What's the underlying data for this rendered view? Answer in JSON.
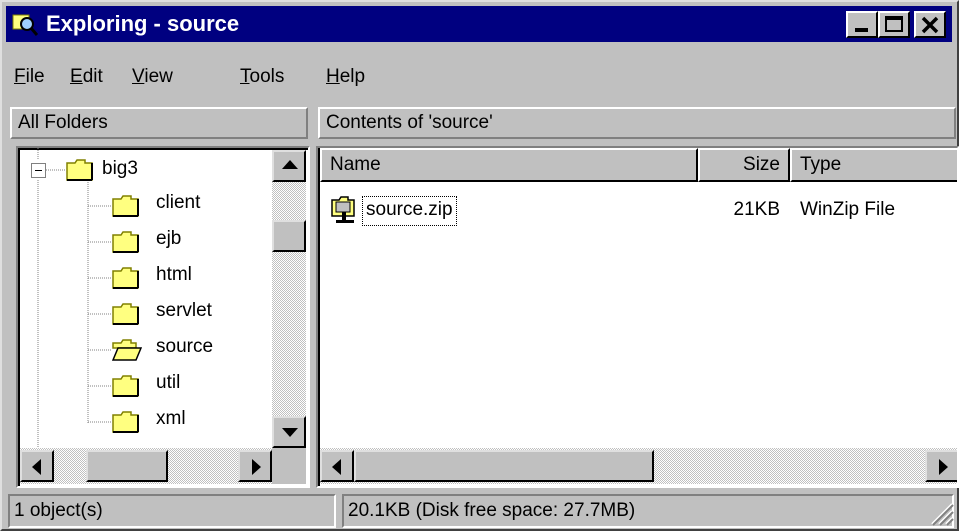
{
  "window": {
    "title": "Exploring - source"
  },
  "menu": [
    {
      "prefix": "",
      "hot": "F",
      "rest": "ile"
    },
    {
      "prefix": "",
      "hot": "E",
      "rest": "dit"
    },
    {
      "prefix": "",
      "hot": "V",
      "rest": "iew"
    },
    {
      "prefix": "",
      "hot": "T",
      "rest": "ools"
    },
    {
      "prefix": "",
      "hot": "H",
      "rest": "elp"
    }
  ],
  "left_header": "All Folders",
  "right_header": "Contents of 'source'",
  "tree": {
    "root": {
      "label": "big3",
      "expander": "−"
    },
    "children": [
      {
        "label": "client",
        "open": false
      },
      {
        "label": "ejb",
        "open": false
      },
      {
        "label": "html",
        "open": false
      },
      {
        "label": "servlet",
        "open": false
      },
      {
        "label": "source",
        "open": true
      },
      {
        "label": "util",
        "open": false
      },
      {
        "label": "xml",
        "open": false
      }
    ]
  },
  "list": {
    "columns": {
      "name": "Name",
      "size": "Size",
      "type": "Type"
    },
    "rows": [
      {
        "name": "source.zip",
        "size": "21KB",
        "type": "WinZip File",
        "icon": "winzip-icon"
      }
    ]
  },
  "status": {
    "left": "1 object(s)",
    "right": "20.1KB (Disk free space: 27.7MB)"
  },
  "colors": {
    "title_bg": "#000080",
    "face": "#c0c0c0",
    "folder": "#ffff80"
  }
}
